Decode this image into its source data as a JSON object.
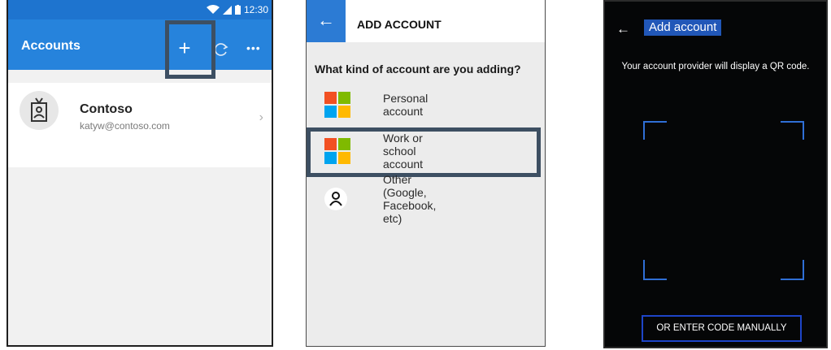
{
  "panel1": {
    "status_time": "12:30",
    "title": "Accounts",
    "actions": {
      "add": "+",
      "more": "•••"
    },
    "account": {
      "name": "Contoso",
      "email": "katyw@contoso.com",
      "chevron": "›"
    },
    "icons": [
      "wifi-icon",
      "signal-icon",
      "battery-icon",
      "plus-icon",
      "refresh-icon",
      "more-icon",
      "id-badge-icon",
      "chevron-right-icon"
    ]
  },
  "panel2": {
    "back": "←",
    "title": "ADD ACCOUNT",
    "question": "What kind of account are you adding?",
    "options": [
      {
        "label": "Personal account",
        "icon": "microsoft-logo-icon"
      },
      {
        "label": "Work or school account",
        "icon": "microsoft-logo-icon"
      },
      {
        "label": "Other (Google, Facebook, etc)",
        "icon": "person-icon"
      }
    ],
    "colors": {
      "header_accent": "#2c7bd4",
      "highlight": "#3d4f62"
    }
  },
  "panel3": {
    "back": "←",
    "title": "Add account",
    "hint": "Your account provider will display a QR code.",
    "manual_button": "OR ENTER CODE MANUALLY",
    "colors": {
      "background": "#050607",
      "accent": "#2157b8",
      "frame": "#2f6fd6"
    }
  }
}
